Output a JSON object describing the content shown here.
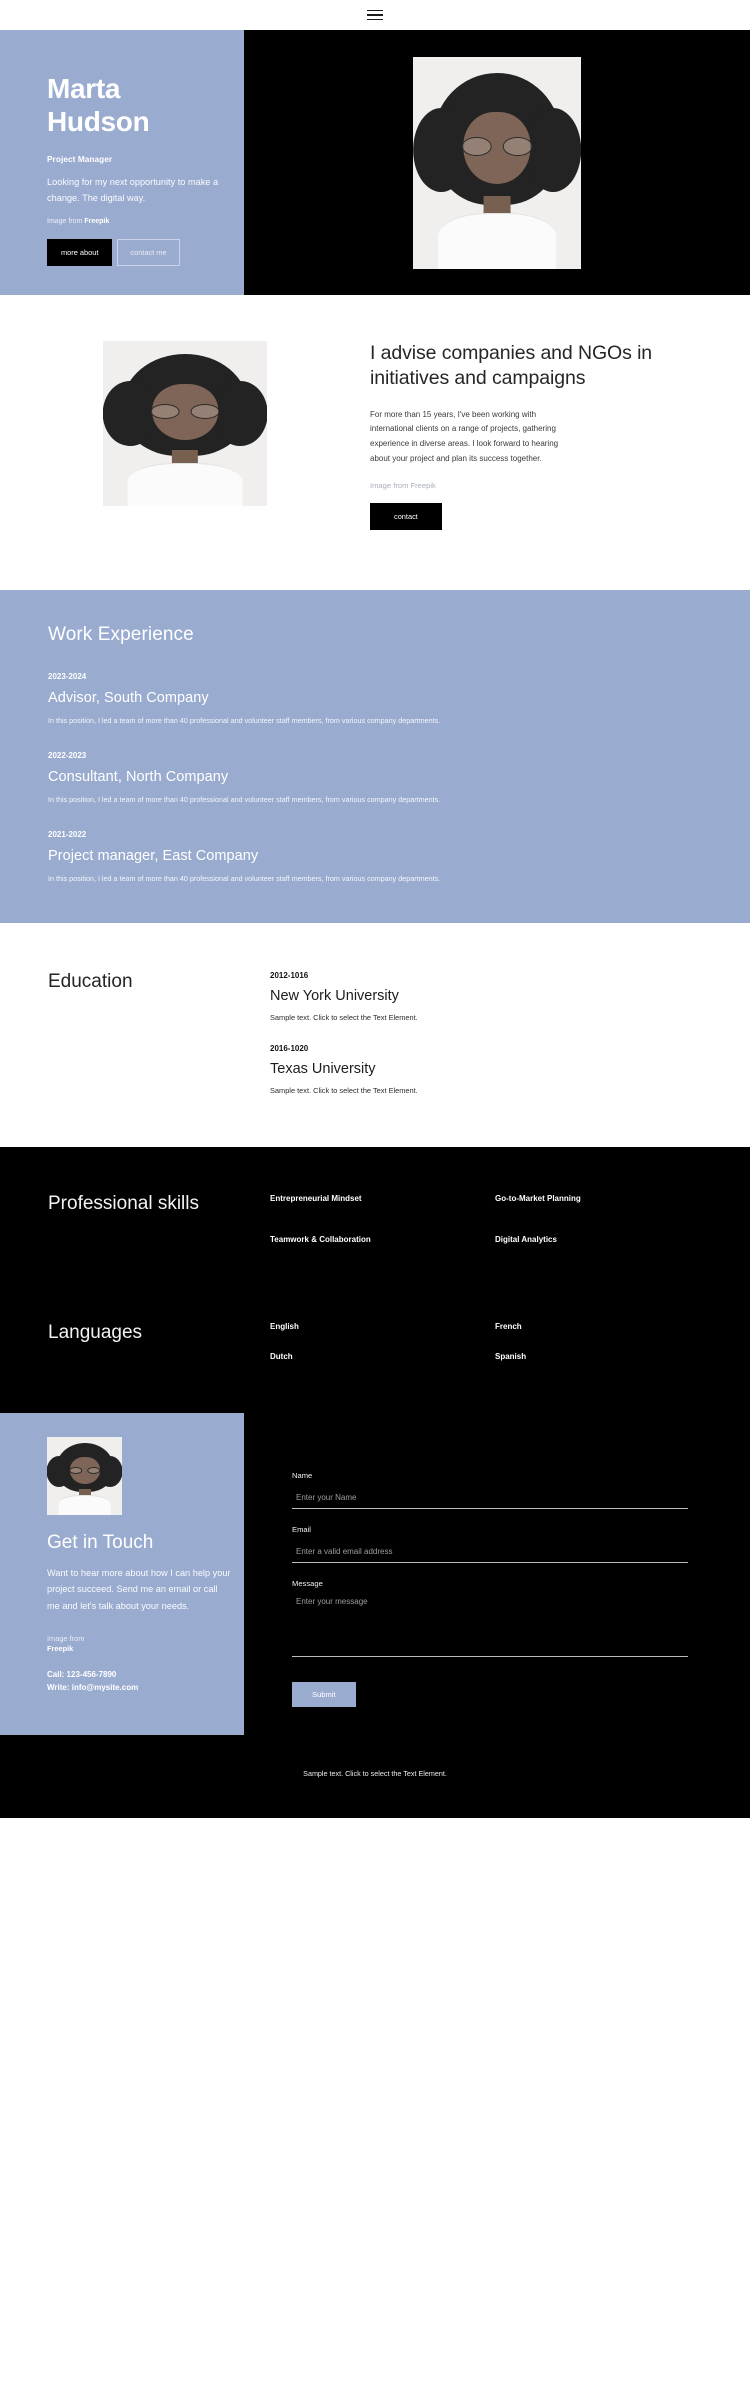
{
  "nav": {
    "menu_icon": "hamburger-menu-icon"
  },
  "hero": {
    "name_line1": "Marta",
    "name_line2": "Hudson",
    "role": "Project Manager",
    "description": "Looking for my next opportunity to make a change. The digital way.",
    "credit_prefix": "Image from ",
    "credit_source": "Freepik",
    "primary_button": "more about",
    "secondary_button": "contact me",
    "photo_alt": "portrait-photo-smiling"
  },
  "advise": {
    "title": "I advise companies and NGOs in initiatives and campaigns",
    "paragraph": "For more than 15 years, I've been working with international clients on a range of projects, gathering experience in diverse areas. I look forward to hearing about your project and plan its success together.",
    "credit_prefix": "Image from ",
    "credit_source": "Freepik",
    "button": "contact",
    "photo_alt": "portrait-photo-thinking"
  },
  "work": {
    "title": "Work Experience",
    "jobs": [
      {
        "years": "2023-2024",
        "role": "Advisor, South Company",
        "description": "In this position, I led a team of more than 40 professional and volunteer staff members, from various company departments."
      },
      {
        "years": "2022-2023",
        "role": "Consultant, North Company",
        "description": "In this position, I led a team of more than 40 professional and volunteer staff members, from various company departments."
      },
      {
        "years": "2021-2022",
        "role": "Project manager, East Company",
        "description": "In this position, I led a team of more than 40 professional and volunteer staff members, from various company departments."
      }
    ]
  },
  "education": {
    "title": "Education",
    "items": [
      {
        "years": "2012-1016",
        "school": "New York University",
        "description": "Sample text. Click to select the Text Element."
      },
      {
        "years": "2016-1020",
        "school": "Texas University",
        "description": "Sample text. Click to select the Text Element."
      }
    ]
  },
  "skills": {
    "title": "Professional skills",
    "items": [
      "Entrepreneurial Mindset",
      "Go-to-Market Planning",
      "Teamwork & Collaboration",
      "Digital Analytics"
    ]
  },
  "languages": {
    "title": "Languages",
    "items": [
      "English",
      "French",
      "Dutch",
      "Spanish"
    ]
  },
  "contact": {
    "title": "Get in Touch",
    "copy": "Want to hear more about how I can help your project succeed. Send me an email or call me and let's talk about your needs.",
    "credit_prefix": "Image from",
    "credit_source": "Freepik",
    "phone": "Call: 123-456-7890",
    "email": "Write: info@mysite.com",
    "photo_alt": "portrait-photo-happy",
    "form": {
      "name_label": "Name",
      "name_placeholder": "Enter your Name",
      "name_value": "",
      "email_label": "Email",
      "email_placeholder": "Enter a valid email address",
      "email_value": "",
      "message_label": "Message",
      "message_placeholder": "Enter your message",
      "message_value": "",
      "submit_label": "Submit"
    }
  },
  "footer": {
    "text": "Sample text. Click to select the Text Element."
  },
  "colors": {
    "accent": "#9aabd0",
    "dark": "#000000",
    "light": "#ffffff"
  }
}
